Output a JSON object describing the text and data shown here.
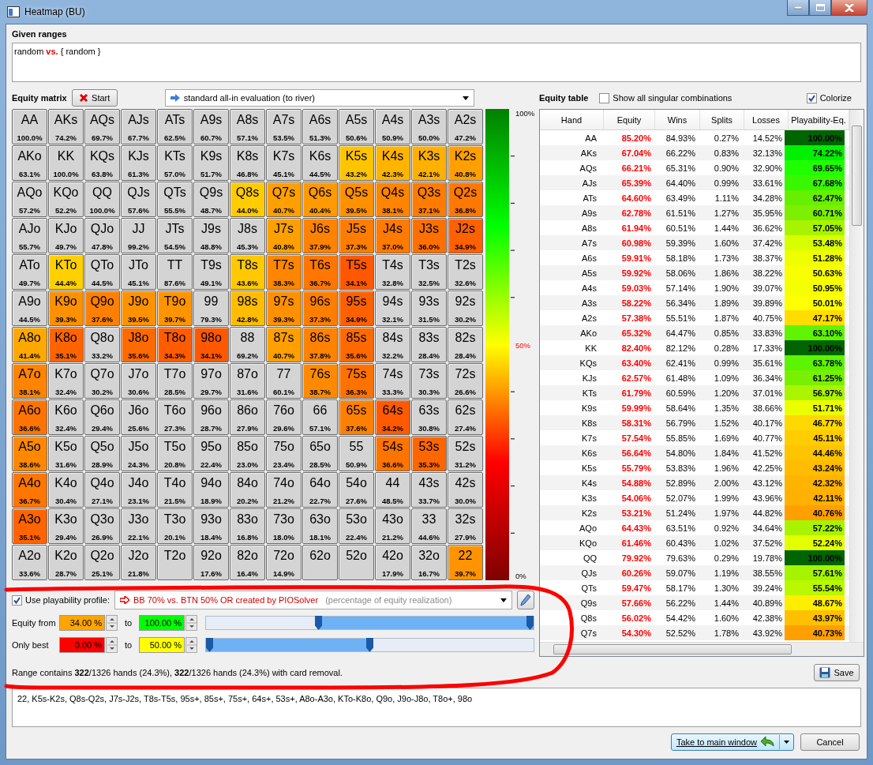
{
  "window": {
    "title": "Heatmap (BU)"
  },
  "given_ranges": {
    "label": "Given ranges",
    "value": "random **vs.** { random }"
  },
  "equity_matrix": {
    "label": "Equity matrix",
    "start_button": "Start",
    "evaluation": "standard all-in evaluation (to river)",
    "rows": [
      {
        "cells": [
          {
            "hand": "AA",
            "pct": "100.0%",
            "color": "#d4d4d4"
          },
          {
            "hand": "AKs",
            "pct": "74.2%",
            "color": "#d4d4d4"
          },
          {
            "hand": "AQs",
            "pct": "69.7%",
            "color": "#d4d4d4"
          },
          {
            "hand": "AJs",
            "pct": "67.7%",
            "color": "#d4d4d4"
          },
          {
            "hand": "ATs",
            "pct": "62.5%",
            "color": "#d4d4d4"
          },
          {
            "hand": "A9s",
            "pct": "60.7%",
            "color": "#d4d4d4"
          },
          {
            "hand": "A8s",
            "pct": "57.1%",
            "color": "#d4d4d4"
          },
          {
            "hand": "A7s",
            "pct": "53.5%",
            "color": "#d4d4d4"
          },
          {
            "hand": "A6s",
            "pct": "51.3%",
            "color": "#d4d4d4"
          },
          {
            "hand": "A5s",
            "pct": "50.6%",
            "color": "#d4d4d4"
          },
          {
            "hand": "A4s",
            "pct": "50.9%",
            "color": "#d4d4d4"
          },
          {
            "hand": "A3s",
            "pct": "50.0%",
            "color": "#d4d4d4"
          },
          {
            "hand": "A2s",
            "pct": "47.2%",
            "color": "#d4d4d4"
          }
        ]
      },
      {
        "cells": [
          {
            "hand": "AKo",
            "pct": "63.1%",
            "color": "#d4d4d4"
          },
          {
            "hand": "KK",
            "pct": "100.0%",
            "color": "#d4d4d4"
          },
          {
            "hand": "KQs",
            "pct": "63.8%",
            "color": "#d4d4d4"
          },
          {
            "hand": "KJs",
            "pct": "61.3%",
            "color": "#d4d4d4"
          },
          {
            "hand": "KTs",
            "pct": "57.0%",
            "color": "#d4d4d4"
          },
          {
            "hand": "K9s",
            "pct": "51.7%",
            "color": "#d4d4d4"
          },
          {
            "hand": "K8s",
            "pct": "46.8%",
            "color": "#d4d4d4"
          },
          {
            "hand": "K7s",
            "pct": "45.1%",
            "color": "#d4d4d4"
          },
          {
            "hand": "K6s",
            "pct": "44.5%",
            "color": "#d4d4d4"
          },
          {
            "hand": "K5s",
            "pct": "43.2%",
            "color": "#ffc400"
          },
          {
            "hand": "K4s",
            "pct": "42.3%",
            "color": "#ffb400"
          },
          {
            "hand": "K3s",
            "pct": "42.1%",
            "color": "#ffb000"
          },
          {
            "hand": "K2s",
            "pct": "40.8%",
            "color": "#ffa000"
          }
        ]
      },
      {
        "cells": [
          {
            "hand": "AQo",
            "pct": "57.2%",
            "color": "#d4d4d4"
          },
          {
            "hand": "KQo",
            "pct": "52.2%",
            "color": "#d4d4d4"
          },
          {
            "hand": "QQ",
            "pct": "100.0%",
            "color": "#d4d4d4"
          },
          {
            "hand": "QJs",
            "pct": "57.6%",
            "color": "#d4d4d4"
          },
          {
            "hand": "QTs",
            "pct": "55.5%",
            "color": "#d4d4d4"
          },
          {
            "hand": "Q9s",
            "pct": "48.7%",
            "color": "#d4d4d4"
          },
          {
            "hand": "Q8s",
            "pct": "44.0%",
            "color": "#ffcc00"
          },
          {
            "hand": "Q7s",
            "pct": "40.7%",
            "color": "#ff9f00"
          },
          {
            "hand": "Q6s",
            "pct": "40.4%",
            "color": "#ff9a00"
          },
          {
            "hand": "Q5s",
            "pct": "39.5%",
            "color": "#ff9000"
          },
          {
            "hand": "Q4s",
            "pct": "38.1%",
            "color": "#ff8400"
          },
          {
            "hand": "Q3s",
            "pct": "37.1%",
            "color": "#ff7c00"
          },
          {
            "hand": "Q2s",
            "pct": "36.8%",
            "color": "#ff7800"
          }
        ]
      },
      {
        "cells": [
          {
            "hand": "AJo",
            "pct": "55.7%",
            "color": "#d4d4d4"
          },
          {
            "hand": "KJo",
            "pct": "49.7%",
            "color": "#d4d4d4"
          },
          {
            "hand": "QJo",
            "pct": "47.8%",
            "color": "#d4d4d4"
          },
          {
            "hand": "JJ",
            "pct": "99.2%",
            "color": "#d4d4d4"
          },
          {
            "hand": "JTs",
            "pct": "54.5%",
            "color": "#d4d4d4"
          },
          {
            "hand": "J9s",
            "pct": "48.8%",
            "color": "#d4d4d4"
          },
          {
            "hand": "J8s",
            "pct": "45.3%",
            "color": "#d4d4d4"
          },
          {
            "hand": "J7s",
            "pct": "40.8%",
            "color": "#ffa000"
          },
          {
            "hand": "J6s",
            "pct": "37.9%",
            "color": "#ff8200"
          },
          {
            "hand": "J5s",
            "pct": "37.3%",
            "color": "#ff7e00"
          },
          {
            "hand": "J4s",
            "pct": "37.0%",
            "color": "#ff7a00"
          },
          {
            "hand": "J3s",
            "pct": "36.0%",
            "color": "#ff7000"
          },
          {
            "hand": "J2s",
            "pct": "34.9%",
            "color": "#ff6000"
          }
        ]
      },
      {
        "cells": [
          {
            "hand": "ATo",
            "pct": "49.7%",
            "color": "#d4d4d4"
          },
          {
            "hand": "KTo",
            "pct": "44.4%",
            "color": "#ffd000"
          },
          {
            "hand": "QTo",
            "pct": "44.5%",
            "color": "#d4d4d4"
          },
          {
            "hand": "JTo",
            "pct": "45.1%",
            "color": "#d4d4d4"
          },
          {
            "hand": "TT",
            "pct": "87.6%",
            "color": "#d4d4d4"
          },
          {
            "hand": "T9s",
            "pct": "49.1%",
            "color": "#d4d4d4"
          },
          {
            "hand": "T8s",
            "pct": "43.6%",
            "color": "#ffc800"
          },
          {
            "hand": "T7s",
            "pct": "38.3%",
            "color": "#ff8600"
          },
          {
            "hand": "T6s",
            "pct": "36.7%",
            "color": "#ff7600"
          },
          {
            "hand": "T5s",
            "pct": "34.1%",
            "color": "#ff5800"
          },
          {
            "hand": "T4s",
            "pct": "32.8%",
            "color": "#d4d4d4"
          },
          {
            "hand": "T3s",
            "pct": "32.5%",
            "color": "#d4d4d4"
          },
          {
            "hand": "T2s",
            "pct": "32.6%",
            "color": "#d4d4d4"
          }
        ]
      },
      {
        "cells": [
          {
            "hand": "A9o",
            "pct": "44.5%",
            "color": "#d4d4d4"
          },
          {
            "hand": "K9o",
            "pct": "39.3%",
            "color": "#ff9000"
          },
          {
            "hand": "Q9o",
            "pct": "37.6%",
            "color": "#ff8000"
          },
          {
            "hand": "J9o",
            "pct": "39.5%",
            "color": "#ff9200"
          },
          {
            "hand": "T9o",
            "pct": "39.7%",
            "color": "#ff9400"
          },
          {
            "hand": "99",
            "pct": "79.3%",
            "color": "#d4d4d4"
          },
          {
            "hand": "98s",
            "pct": "42.8%",
            "color": "#ffbc00"
          },
          {
            "hand": "97s",
            "pct": "39.3%",
            "color": "#ff9000"
          },
          {
            "hand": "96s",
            "pct": "37.3%",
            "color": "#ff7e00"
          },
          {
            "hand": "95s",
            "pct": "34.9%",
            "color": "#ff6000"
          },
          {
            "hand": "94s",
            "pct": "32.1%",
            "color": "#d4d4d4"
          },
          {
            "hand": "93s",
            "pct": "31.5%",
            "color": "#d4d4d4"
          },
          {
            "hand": "92s",
            "pct": "30.2%",
            "color": "#d4d4d4"
          }
        ]
      },
      {
        "cells": [
          {
            "hand": "A8o",
            "pct": "41.4%",
            "color": "#ffa800"
          },
          {
            "hand": "K8o",
            "pct": "35.1%",
            "color": "#ff6400"
          },
          {
            "hand": "Q8o",
            "pct": "33.2%",
            "color": "#d4d4d4"
          },
          {
            "hand": "J8o",
            "pct": "35.6%",
            "color": "#ff6a00"
          },
          {
            "hand": "T8o",
            "pct": "34.3%",
            "color": "#ff5c00"
          },
          {
            "hand": "98o",
            "pct": "34.1%",
            "color": "#ff5800"
          },
          {
            "hand": "88",
            "pct": "69.2%",
            "color": "#d4d4d4"
          },
          {
            "hand": "87s",
            "pct": "40.7%",
            "color": "#ff9f00"
          },
          {
            "hand": "86s",
            "pct": "37.8%",
            "color": "#ff8200"
          },
          {
            "hand": "85s",
            "pct": "35.6%",
            "color": "#ff6a00"
          },
          {
            "hand": "84s",
            "pct": "32.2%",
            "color": "#d4d4d4"
          },
          {
            "hand": "83s",
            "pct": "28.4%",
            "color": "#d4d4d4"
          },
          {
            "hand": "82s",
            "pct": "28.4%",
            "color": "#d4d4d4"
          }
        ]
      },
      {
        "cells": [
          {
            "hand": "A7o",
            "pct": "38.1%",
            "color": "#ff8400"
          },
          {
            "hand": "K7o",
            "pct": "32.4%",
            "color": "#d4d4d4"
          },
          {
            "hand": "Q7o",
            "pct": "30.2%",
            "color": "#d4d4d4"
          },
          {
            "hand": "J7o",
            "pct": "30.6%",
            "color": "#d4d4d4"
          },
          {
            "hand": "T7o",
            "pct": "28.5%",
            "color": "#d4d4d4"
          },
          {
            "hand": "97o",
            "pct": "29.7%",
            "color": "#d4d4d4"
          },
          {
            "hand": "87o",
            "pct": "31.6%",
            "color": "#d4d4d4"
          },
          {
            "hand": "77",
            "pct": "60.1%",
            "color": "#d4d4d4"
          },
          {
            "hand": "76s",
            "pct": "38.7%",
            "color": "#ff8a00"
          },
          {
            "hand": "75s",
            "pct": "36.3%",
            "color": "#ff7200"
          },
          {
            "hand": "74s",
            "pct": "33.3%",
            "color": "#d4d4d4"
          },
          {
            "hand": "73s",
            "pct": "30.3%",
            "color": "#d4d4d4"
          },
          {
            "hand": "72s",
            "pct": "26.6%",
            "color": "#d4d4d4"
          }
        ]
      },
      {
        "cells": [
          {
            "hand": "A6o",
            "pct": "36.6%",
            "color": "#ff7400"
          },
          {
            "hand": "K6o",
            "pct": "32.4%",
            "color": "#d4d4d4"
          },
          {
            "hand": "Q6o",
            "pct": "29.4%",
            "color": "#d4d4d4"
          },
          {
            "hand": "J6o",
            "pct": "25.6%",
            "color": "#d4d4d4"
          },
          {
            "hand": "T6o",
            "pct": "27.3%",
            "color": "#d4d4d4"
          },
          {
            "hand": "96o",
            "pct": "28.7%",
            "color": "#d4d4d4"
          },
          {
            "hand": "86o",
            "pct": "27.9%",
            "color": "#d4d4d4"
          },
          {
            "hand": "76o",
            "pct": "29.6%",
            "color": "#d4d4d4"
          },
          {
            "hand": "66",
            "pct": "57.1%",
            "color": "#d4d4d4"
          },
          {
            "hand": "65s",
            "pct": "37.6%",
            "color": "#ff8000"
          },
          {
            "hand": "64s",
            "pct": "34.2%",
            "color": "#ff5a00"
          },
          {
            "hand": "63s",
            "pct": "30.8%",
            "color": "#d4d4d4"
          },
          {
            "hand": "62s",
            "pct": "27.4%",
            "color": "#d4d4d4"
          }
        ]
      },
      {
        "cells": [
          {
            "hand": "A5o",
            "pct": "38.6%",
            "color": "#ff8800"
          },
          {
            "hand": "K5o",
            "pct": "31.6%",
            "color": "#d4d4d4"
          },
          {
            "hand": "Q5o",
            "pct": "28.9%",
            "color": "#d4d4d4"
          },
          {
            "hand": "J5o",
            "pct": "24.3%",
            "color": "#d4d4d4"
          },
          {
            "hand": "T5o",
            "pct": "20.8%",
            "color": "#d4d4d4"
          },
          {
            "hand": "95o",
            "pct": "22.4%",
            "color": "#d4d4d4"
          },
          {
            "hand": "85o",
            "pct": "23.0%",
            "color": "#d4d4d4"
          },
          {
            "hand": "75o",
            "pct": "23.4%",
            "color": "#d4d4d4"
          },
          {
            "hand": "65o",
            "pct": "28.5%",
            "color": "#d4d4d4"
          },
          {
            "hand": "55",
            "pct": "50.9%",
            "color": "#d4d4d4"
          },
          {
            "hand": "54s",
            "pct": "36.6%",
            "color": "#ff7400"
          },
          {
            "hand": "53s",
            "pct": "35.3%",
            "color": "#ff6600"
          },
          {
            "hand": "52s",
            "pct": "31.2%",
            "color": "#d4d4d4"
          }
        ]
      },
      {
        "cells": [
          {
            "hand": "A4o",
            "pct": "36.7%",
            "color": "#ff7600"
          },
          {
            "hand": "K4o",
            "pct": "30.4%",
            "color": "#d4d4d4"
          },
          {
            "hand": "Q4o",
            "pct": "27.1%",
            "color": "#d4d4d4"
          },
          {
            "hand": "J4o",
            "pct": "23.1%",
            "color": "#d4d4d4"
          },
          {
            "hand": "T4o",
            "pct": "21.5%",
            "color": "#d4d4d4"
          },
          {
            "hand": "94o",
            "pct": "18.9%",
            "color": "#d4d4d4"
          },
          {
            "hand": "84o",
            "pct": "20.2%",
            "color": "#d4d4d4"
          },
          {
            "hand": "74o",
            "pct": "21.2%",
            "color": "#d4d4d4"
          },
          {
            "hand": "64o",
            "pct": "22.7%",
            "color": "#d4d4d4"
          },
          {
            "hand": "54o",
            "pct": "27.6%",
            "color": "#d4d4d4"
          },
          {
            "hand": "44",
            "pct": "48.5%",
            "color": "#d4d4d4"
          },
          {
            "hand": "43s",
            "pct": "33.7%",
            "color": "#d4d4d4"
          },
          {
            "hand": "42s",
            "pct": "30.0%",
            "color": "#d4d4d4"
          }
        ]
      },
      {
        "cells": [
          {
            "hand": "A3o",
            "pct": "35.1%",
            "color": "#ff6400"
          },
          {
            "hand": "K3o",
            "pct": "29.4%",
            "color": "#d4d4d4"
          },
          {
            "hand": "Q3o",
            "pct": "26.9%",
            "color": "#d4d4d4"
          },
          {
            "hand": "J3o",
            "pct": "22.1%",
            "color": "#d4d4d4"
          },
          {
            "hand": "T3o",
            "pct": "20.1%",
            "color": "#d4d4d4"
          },
          {
            "hand": "93o",
            "pct": "18.4%",
            "color": "#d4d4d4"
          },
          {
            "hand": "83o",
            "pct": "16.8%",
            "color": "#d4d4d4"
          },
          {
            "hand": "73o",
            "pct": "18.0%",
            "color": "#d4d4d4"
          },
          {
            "hand": "63o",
            "pct": "18.1%",
            "color": "#d4d4d4"
          },
          {
            "hand": "53o",
            "pct": "22.4%",
            "color": "#d4d4d4"
          },
          {
            "hand": "43o",
            "pct": "21.2%",
            "color": "#d4d4d4"
          },
          {
            "hand": "33",
            "pct": "44.6%",
            "color": "#d4d4d4"
          },
          {
            "hand": "32s",
            "pct": "27.9%",
            "color": "#d4d4d4"
          }
        ]
      },
      {
        "cells": [
          {
            "hand": "A2o",
            "pct": "33.6%",
            "color": "#d4d4d4"
          },
          {
            "hand": "K2o",
            "pct": "28.7%",
            "color": "#d4d4d4"
          },
          {
            "hand": "Q2o",
            "pct": "25.1%",
            "color": "#d4d4d4"
          },
          {
            "hand": "J2o",
            "pct": "21.8%",
            "color": "#d4d4d4"
          },
          {
            "hand": "T2o",
            "color": "#d4d4d4"
          },
          {
            "hand": "92o",
            "pct": "17.6%",
            "color": "#d4d4d4"
          },
          {
            "hand": "82o",
            "pct": "16.4%",
            "color": "#d4d4d4"
          },
          {
            "hand": "72o",
            "pct": "14.9%",
            "color": "#d4d4d4"
          },
          {
            "hand": "62o",
            "color": "#d4d4d4"
          },
          {
            "hand": "52o",
            "color": "#d4d4d4"
          },
          {
            "hand": "42o",
            "pct": "17.9%",
            "color": "#d4d4d4"
          },
          {
            "hand": "32o",
            "pct": "16.7%",
            "color": "#d4d4d4"
          },
          {
            "hand": "22",
            "pct": "39.7%",
            "color": "#ff9400"
          }
        ]
      }
    ]
  },
  "legend": {
    "labels": [
      {
        "text": "100%",
        "kind": "end"
      },
      {
        "text": "50%",
        "kind": "marker"
      },
      {
        "text": "0%",
        "kind": "end"
      }
    ]
  },
  "equity_table": {
    "label": "Equity table",
    "show_all": {
      "label": "Show all singular combinations",
      "checked": false
    },
    "colorize": {
      "label": "Colorize",
      "checked": true
    },
    "columns": [
      "Hand",
      "Equity",
      "Wins",
      "Splits",
      "Losses",
      "Playability-Eq."
    ],
    "rows": [
      {
        "hand": "AA",
        "equity": "85.20%",
        "wins": "84.93%",
        "splits": "0.27%",
        "losses": "14.52%",
        "playability": "100.00%",
        "color": "#006400"
      },
      {
        "hand": "AKs",
        "equity": "67.04%",
        "wins": "66.22%",
        "splits": "0.83%",
        "losses": "32.13%",
        "playability": "74.22%",
        "color": "#00f000"
      },
      {
        "hand": "AQs",
        "equity": "66.21%",
        "wins": "65.31%",
        "splits": "0.90%",
        "losses": "32.90%",
        "playability": "69.65%",
        "color": "#20ff00"
      },
      {
        "hand": "AJs",
        "equity": "65.39%",
        "wins": "64.40%",
        "splits": "0.99%",
        "losses": "33.61%",
        "playability": "67.68%",
        "color": "#38f800"
      },
      {
        "hand": "ATs",
        "equity": "64.60%",
        "wins": "63.49%",
        "splits": "1.11%",
        "losses": "34.28%",
        "playability": "62.47%",
        "color": "#66f000"
      },
      {
        "hand": "A9s",
        "equity": "62.78%",
        "wins": "61.51%",
        "splits": "1.27%",
        "losses": "35.95%",
        "playability": "60.71%",
        "color": "#7cf000"
      },
      {
        "hand": "A8s",
        "equity": "61.94%",
        "wins": "60.51%",
        "splits": "1.44%",
        "losses": "36.62%",
        "playability": "57.05%",
        "color": "#a8f400"
      },
      {
        "hand": "A7s",
        "equity": "60.98%",
        "wins": "59.39%",
        "splits": "1.60%",
        "losses": "37.42%",
        "playability": "53.48%",
        "color": "#d8ff00"
      },
      {
        "hand": "A6s",
        "equity": "59.91%",
        "wins": "58.18%",
        "splits": "1.73%",
        "losses": "38.37%",
        "playability": "51.28%",
        "color": "#f0ff00"
      },
      {
        "hand": "A5s",
        "equity": "59.92%",
        "wins": "58.06%",
        "splits": "1.86%",
        "losses": "38.22%",
        "playability": "50.63%",
        "color": "#f8ff00"
      },
      {
        "hand": "A4s",
        "equity": "59.03%",
        "wins": "57.14%",
        "splits": "1.90%",
        "losses": "39.07%",
        "playability": "50.95%",
        "color": "#f6ff00"
      },
      {
        "hand": "A3s",
        "equity": "58.22%",
        "wins": "56.34%",
        "splits": "1.89%",
        "losses": "39.89%",
        "playability": "50.01%",
        "color": "#ffff00"
      },
      {
        "hand": "A2s",
        "equity": "57.38%",
        "wins": "55.51%",
        "splits": "1.87%",
        "losses": "40.75%",
        "playability": "47.17%",
        "color": "#ffdd00"
      },
      {
        "hand": "AKo",
        "equity": "65.32%",
        "wins": "64.47%",
        "splits": "0.85%",
        "losses": "33.83%",
        "playability": "63.10%",
        "color": "#60f400"
      },
      {
        "hand": "KK",
        "equity": "82.40%",
        "wins": "82.12%",
        "splits": "0.28%",
        "losses": "17.33%",
        "playability": "100.00%",
        "color": "#006400"
      },
      {
        "hand": "KQs",
        "equity": "63.40%",
        "wins": "62.41%",
        "splits": "0.99%",
        "losses": "35.61%",
        "playability": "63.78%",
        "color": "#5cf400"
      },
      {
        "hand": "KJs",
        "equity": "62.57%",
        "wins": "61.48%",
        "splits": "1.09%",
        "losses": "36.34%",
        "playability": "61.25%",
        "color": "#78f000"
      },
      {
        "hand": "KTs",
        "equity": "61.79%",
        "wins": "60.59%",
        "splits": "1.20%",
        "losses": "37.01%",
        "playability": "56.97%",
        "color": "#aaf400"
      },
      {
        "hand": "K9s",
        "equity": "59.99%",
        "wins": "58.64%",
        "splits": "1.35%",
        "losses": "38.66%",
        "playability": "51.71%",
        "color": "#ecff00"
      },
      {
        "hand": "K8s",
        "equity": "58.31%",
        "wins": "56.79%",
        "splits": "1.52%",
        "losses": "40.17%",
        "playability": "46.77%",
        "color": "#ffd800"
      },
      {
        "hand": "K7s",
        "equity": "57.54%",
        "wins": "55.85%",
        "splits": "1.69%",
        "losses": "40.77%",
        "playability": "45.11%",
        "color": "#ffcc00"
      },
      {
        "hand": "K6s",
        "equity": "56.64%",
        "wins": "54.80%",
        "splits": "1.84%",
        "losses": "41.52%",
        "playability": "44.46%",
        "color": "#ffc400"
      },
      {
        "hand": "K5s",
        "equity": "55.79%",
        "wins": "53.83%",
        "splits": "1.96%",
        "losses": "42.25%",
        "playability": "43.24%",
        "color": "#ffbc00"
      },
      {
        "hand": "K4s",
        "equity": "54.88%",
        "wins": "52.89%",
        "splits": "2.00%",
        "losses": "43.12%",
        "playability": "42.32%",
        "color": "#ffb400"
      },
      {
        "hand": "K3s",
        "equity": "54.06%",
        "wins": "52.07%",
        "splits": "1.99%",
        "losses": "43.96%",
        "playability": "42.11%",
        "color": "#ffb000"
      },
      {
        "hand": "K2s",
        "equity": "53.21%",
        "wins": "51.24%",
        "splits": "1.97%",
        "losses": "44.82%",
        "playability": "40.76%",
        "color": "#ffa000"
      },
      {
        "hand": "AQo",
        "equity": "64.43%",
        "wins": "63.51%",
        "splits": "0.92%",
        "losses": "34.64%",
        "playability": "57.22%",
        "color": "#a8f400"
      },
      {
        "hand": "KQo",
        "equity": "61.46%",
        "wins": "60.43%",
        "splits": "1.02%",
        "losses": "37.52%",
        "playability": "52.24%",
        "color": "#e4ff00"
      },
      {
        "hand": "QQ",
        "equity": "79.92%",
        "wins": "79.63%",
        "splits": "0.29%",
        "losses": "19.78%",
        "playability": "100.00%",
        "color": "#006400"
      },
      {
        "hand": "QJs",
        "equity": "60.26%",
        "wins": "59.07%",
        "splits": "1.19%",
        "losses": "38.55%",
        "playability": "57.61%",
        "color": "#a4f400"
      },
      {
        "hand": "QTs",
        "equity": "59.47%",
        "wins": "58.17%",
        "splits": "1.30%",
        "losses": "39.24%",
        "playability": "55.54%",
        "color": "#baf800"
      },
      {
        "hand": "Q9s",
        "equity": "57.66%",
        "wins": "56.22%",
        "splits": "1.44%",
        "losses": "40.89%",
        "playability": "48.67%",
        "color": "#ffee00"
      },
      {
        "hand": "Q8s",
        "equity": "56.02%",
        "wins": "54.42%",
        "splits": "1.60%",
        "losses": "42.38%",
        "playability": "43.97%",
        "color": "#ffc000"
      },
      {
        "hand": "Q7s",
        "equity": "54.30%",
        "wins": "52.52%",
        "splits": "1.78%",
        "losses": "43.92%",
        "playability": "40.73%",
        "color": "#ffa000"
      }
    ]
  },
  "playability": {
    "label": "Use playability profile:",
    "checked": true,
    "profile": "BB 70% vs. BTN 50% OR created by PIOSolver",
    "profile_note": "(percentage of equity realization)"
  },
  "ranges": [
    {
      "label": "Equity from",
      "from": {
        "value": "34.00 %",
        "color": "#ffa500"
      },
      "to_label": "to",
      "to": {
        "value": "100.00 %",
        "color": "#00ff00"
      },
      "thumbs": [
        {
          "level": 0.34
        },
        {
          "level": 1
        }
      ]
    },
    {
      "label": "Only best",
      "from": {
        "value": "0.00 %",
        "color": "#ff0000"
      },
      "to_label": "to",
      "to": {
        "value": "50.00 %",
        "color": "#ffff00"
      },
      "thumbs": [
        {
          "level": 0
        },
        {
          "level": 0.5
        }
      ]
    }
  ],
  "range_summary": "Range contains **322**/1326 hands (24.3%), **322**/1326 hands (24.3%) with card removal.",
  "save_button": "Save",
  "range_text": "22, K5s-K2s, Q8s-Q2s, J7s-J2s, T8s-T5s, 95s+, 85s+, 75s+, 64s+, 53s+, A8o-A3o, KTo-K8o, Q9o, J9o-J8o, T8o+, 98o",
  "buttons": {
    "take": "Take to main window",
    "cancel": "Cancel"
  }
}
